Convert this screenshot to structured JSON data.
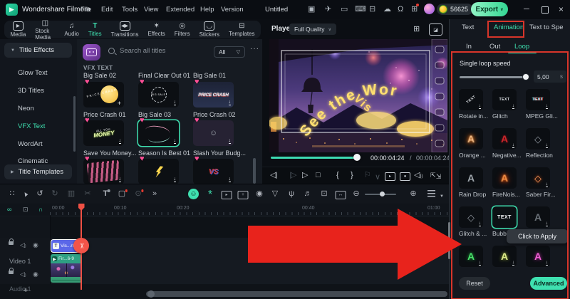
{
  "app": {
    "brand": "Wondershare Filmora",
    "menus": [
      "File",
      "Edit",
      "Tools",
      "View",
      "Extended",
      "Help",
      "Version"
    ],
    "project_title": "Untitled",
    "coins": "56625",
    "export_label": "Export"
  },
  "media_tabs": [
    {
      "label": "Media"
    },
    {
      "label": "Stock Media"
    },
    {
      "label": "Audio"
    },
    {
      "label": "Titles"
    },
    {
      "label": "Transitions"
    },
    {
      "label": "Effects"
    },
    {
      "label": "Filters"
    },
    {
      "label": "Stickers"
    },
    {
      "label": "Templates"
    }
  ],
  "sidebar": {
    "items": [
      {
        "label": "Title Effects"
      },
      {
        "label": "Glow Text"
      },
      {
        "label": "3D Titles"
      },
      {
        "label": "Neon"
      },
      {
        "label": "VFX Text"
      },
      {
        "label": "WordArt"
      },
      {
        "label": "Cinematic"
      },
      {
        "label": "Title Templates"
      }
    ]
  },
  "library": {
    "search_placeholder": "Search all titles",
    "filter_all": "All",
    "section_title": "VFX TEXT",
    "labels": [
      "Big Sale 02",
      "Final Clear Out 01",
      "Big Sale 01",
      "Price Crash 01",
      "Big Sale 03",
      "Price Crash 02",
      "Save You Money...",
      "Season Is Best 01",
      "Slash Your Budg..."
    ],
    "art": {
      "price_scatter": "PRICE CRASH",
      "big_sale": "BIG SALE",
      "price_bold": "PRICE CRASH",
      "money_top": "ALL YOU",
      "money": "MONEY",
      "vs": "VS"
    }
  },
  "player": {
    "label": "Player",
    "quality": "Full Quality",
    "arc_text_1": "See the Wor",
    "arc_text_2": "Vis",
    "current_time": "00:00:04:24",
    "separator": "/",
    "duration": "00:00:04:24"
  },
  "right_panel": {
    "tabs": [
      "Text",
      "Animation",
      "Text to Spe"
    ],
    "subtabs": [
      "In",
      "Out",
      "Loop"
    ],
    "speed_label": "Single loop speed",
    "speed_value": "5,00",
    "speed_unit": "s",
    "animations": [
      "Rotate in...",
      "Glitch",
      "MPEG Gli...",
      "Orange ...",
      "Negative...",
      "Reflection",
      "Rain Drop",
      "FireNois...",
      "Saber Fir...",
      "Glitch & ...",
      "Bubb..."
    ],
    "glyph_text": "TEXT",
    "glyph_a": "A",
    "tooltip": "Click to Apply",
    "reset_label": "Reset",
    "advanced_label": "Advanced"
  },
  "timeline": {
    "ruler": [
      "00:00",
      "00:10",
      "00:20",
      "00:40",
      "01:00"
    ],
    "video_track_label": "Video 1",
    "audio_track_label": "Audio 1",
    "text_clip_label": "Vis...rld",
    "video_clip_label": "Fir...6-9"
  },
  "colors": {
    "accent_teal": "#3fe0b0",
    "annotation_red": "#d8352a",
    "arrow_red": "#e8231c",
    "heart_pink": "#ff4f96",
    "clip_purple": "#5b67e8",
    "clip_teal": "#2fa183"
  }
}
